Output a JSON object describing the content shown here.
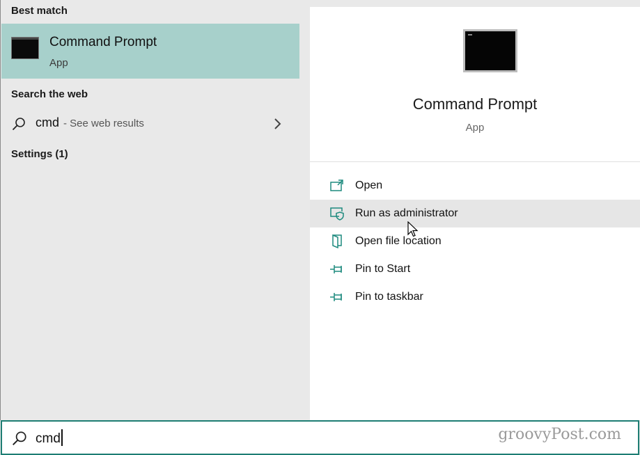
{
  "colors": {
    "accent": "#1d8a7e",
    "selected_bg": "#a7d0cb",
    "hover_bg": "#e6e6e6"
  },
  "left": {
    "best_match_title": "Best match",
    "best_match": {
      "title": "Command Prompt",
      "subtitle": "App",
      "icon": "command-prompt-icon"
    },
    "search_web_title": "Search the web",
    "web_result": {
      "query": "cmd",
      "hint": "- See web results",
      "icon": "search-icon",
      "chevron": "chevron-right-icon"
    },
    "settings_title": "Settings (1)"
  },
  "preview": {
    "title": "Command Prompt",
    "subtitle": "App",
    "actions": [
      {
        "label": "Open",
        "icon": "open-window-icon"
      },
      {
        "label": "Run as administrator",
        "icon": "shield-admin-icon"
      },
      {
        "label": "Open file location",
        "icon": "file-location-icon"
      },
      {
        "label": "Pin to Start",
        "icon": "pin-icon"
      },
      {
        "label": "Pin to taskbar",
        "icon": "pin-icon"
      }
    ]
  },
  "search": {
    "value": "cmd",
    "icon": "search-icon"
  },
  "watermark": "groovyPost.com"
}
